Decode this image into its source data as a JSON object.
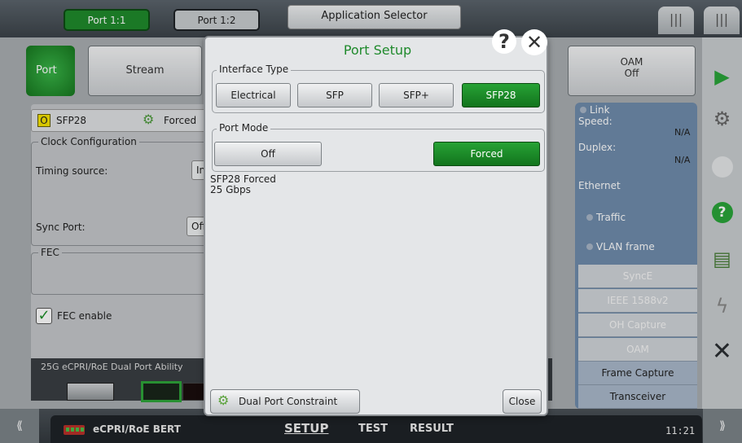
{
  "top": {
    "port_tabs": [
      "Port 1:1",
      "Port 1:2"
    ],
    "app_selector": "Application Selector",
    "right_tabs": [
      "|||",
      "|||"
    ]
  },
  "func": {
    "port": "Port",
    "stream": "Stream",
    "oam_line1": "OAM",
    "oam_line2": "Off"
  },
  "left": {
    "sfp_indicator": "O",
    "sfp_label": "SFP28",
    "mode_label": "Forced",
    "clock_group": "Clock Configuration",
    "timing_label": "Timing source:",
    "timing_value": "In",
    "sync_label": "Sync Port:",
    "sync_value": "Off",
    "fec_group": "FEC",
    "fec_enable": "FEC enable",
    "fec_check": "✓",
    "ability_label": "25G eCPRI/RoE Dual Port Ability"
  },
  "status": {
    "link": "Link",
    "speed": "Speed:",
    "speed_val": "N/A",
    "duplex": "Duplex:",
    "duplex_val": "N/A",
    "ethernet": "Ethernet",
    "traffic": "Traffic",
    "vlan": "VLAN frame",
    "features": [
      "SyncE",
      "IEEE 1588v2",
      "OH Capture",
      "OAM",
      "Frame Capture",
      "Transceiver"
    ]
  },
  "sidebar_icons": [
    "play-icon",
    "signal-icon",
    "circle-icon",
    "help-icon",
    "report-icon",
    "lightning-icon",
    "close-icon"
  ],
  "bottom": {
    "left_chevron": "⟪",
    "right_chevron": "⟫",
    "app_name": "eCPRI/RoE BERT",
    "tabs": [
      "SETUP",
      "TEST",
      "RESULT"
    ],
    "time": "11:21"
  },
  "dialog": {
    "title": "Port Setup",
    "help": "?",
    "close_x": "✕",
    "interface_group": "Interface Type",
    "interface_options": [
      "Electrical",
      "SFP",
      "SFP+",
      "SFP28"
    ],
    "interface_selected": "SFP28",
    "mode_group": "Port Mode",
    "mode_options": [
      "Off",
      "Forced"
    ],
    "mode_selected": "Forced",
    "status_line1": "SFP28 Forced",
    "status_line2": "25 Gbps",
    "dual_port_button": "Dual Port Constraint",
    "close_button": "Close"
  },
  "colors": {
    "accent_green": "#1f8a2c",
    "status_blue": "#6f8bab"
  }
}
